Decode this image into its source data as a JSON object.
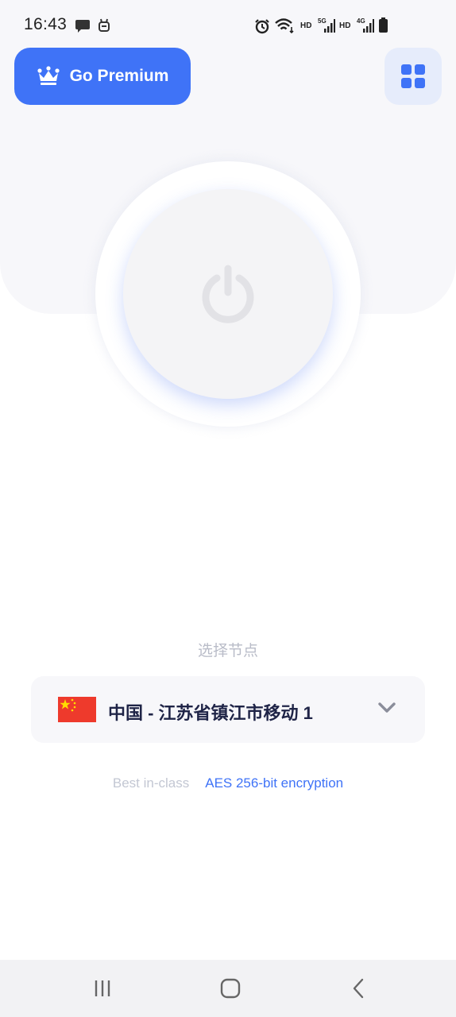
{
  "status_bar": {
    "time": "16:43",
    "icons": [
      "message-icon",
      "robot-icon",
      "alarm-icon",
      "wifi-icon",
      "signal-icon",
      "battery-icon"
    ],
    "hd_1": "HD",
    "net_1": "5G",
    "hd_2": "HD",
    "net_2": "4G"
  },
  "header": {
    "premium_label": "Go Premium",
    "premium_icon": "crown-icon",
    "menu_icon": "grid-menu-icon"
  },
  "power": {
    "icon": "power-icon"
  },
  "server": {
    "section_label": "选择节点",
    "name": "中国 - 江苏省镇江市移动 1",
    "flag_icon": "china-flag-icon",
    "chevron_icon": "chevron-down-icon"
  },
  "encryption": {
    "prefix": "Best in-class",
    "highlight": "AES 256-bit encryption"
  },
  "nav": {
    "recents_icon": "recents-icon",
    "home_icon": "home-icon",
    "back_icon": "back-icon"
  },
  "colors": {
    "accent": "#3f73f7",
    "top_background": "#f7f7fa",
    "server_text": "#1f2447",
    "muted_text": "#b9bcc8"
  }
}
